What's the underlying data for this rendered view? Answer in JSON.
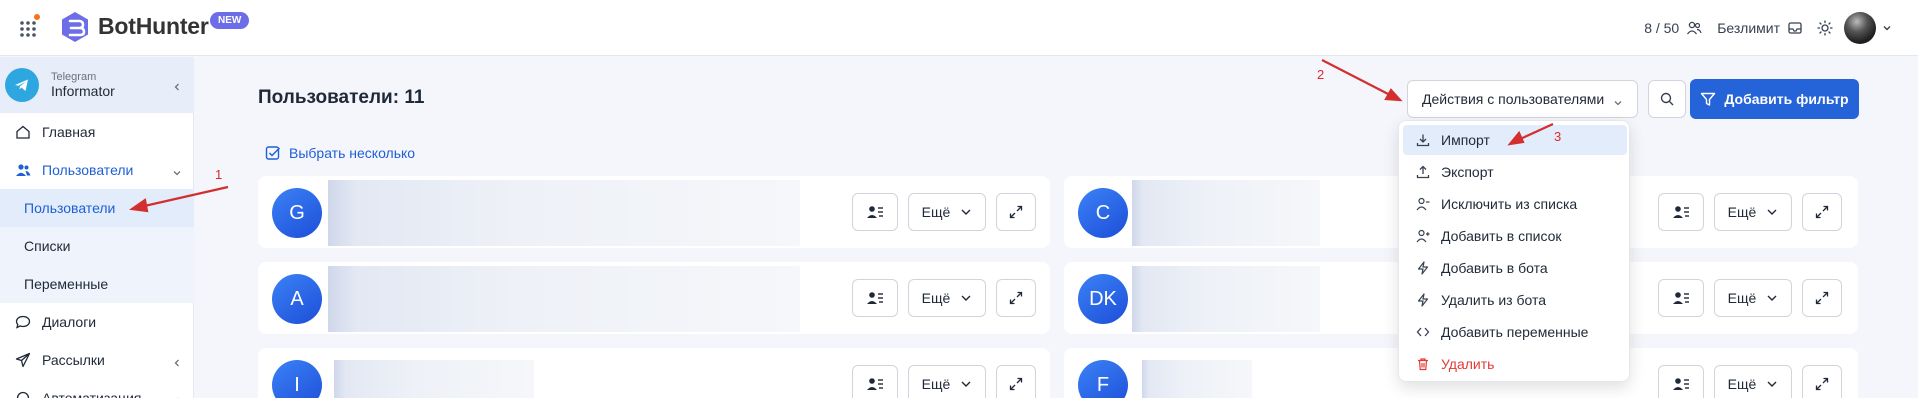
{
  "header": {
    "brand": "BotHunter",
    "badge": "NEW",
    "usage": "8 / 50",
    "plan": "Безлимит",
    "icons": [
      "apps-grid-icon",
      "logo-icon",
      "users-icon",
      "inbox-icon",
      "sun-icon",
      "avatar",
      "chevron-down-icon"
    ]
  },
  "sidebar": {
    "account": {
      "subtitle": "Telegram",
      "name": "Informator"
    },
    "items": [
      {
        "label": "Главная",
        "icon": "home-icon"
      },
      {
        "label": "Пользователи",
        "icon": "users-icon"
      },
      {
        "label": "Пользователи"
      },
      {
        "label": "Списки"
      },
      {
        "label": "Переменные"
      },
      {
        "label": "Диалоги",
        "icon": "chat-icon"
      },
      {
        "label": "Рассылки",
        "icon": "send-icon"
      },
      {
        "label": "Автоматизация",
        "icon": "automation-icon"
      }
    ]
  },
  "main": {
    "title": "Пользователи: 11",
    "select_multiple": "Выбрать несколько",
    "actions_label": "Действия с пользователями",
    "add_filter": "Добавить фильтр",
    "cards": [
      {
        "initials": "G"
      },
      {
        "initials": "C"
      },
      {
        "initials": "A"
      },
      {
        "initials": "DK"
      },
      {
        "initials": "I"
      },
      {
        "initials": "F"
      }
    ],
    "more_label": "Ещё"
  },
  "menu": {
    "items": [
      {
        "label": "Импорт",
        "icon": "download-icon"
      },
      {
        "label": "Экспорт",
        "icon": "upload-icon"
      },
      {
        "label": "Исключить из списка",
        "icon": "user-minus-icon"
      },
      {
        "label": "Добавить в список",
        "icon": "user-plus-icon"
      },
      {
        "label": "Добавить в бота",
        "icon": "bolt-icon"
      },
      {
        "label": "Удалить из бота",
        "icon": "bolt-off-icon"
      },
      {
        "label": "Добавить переменные",
        "icon": "code-icon"
      },
      {
        "label": "Удалить",
        "icon": "trash-icon"
      }
    ]
  },
  "annotations": {
    "n1": "1",
    "n2": "2",
    "n3": "3"
  },
  "colors": {
    "accent": "#2563d9",
    "annotation": "#d32f2f",
    "danger": "#e53935"
  }
}
